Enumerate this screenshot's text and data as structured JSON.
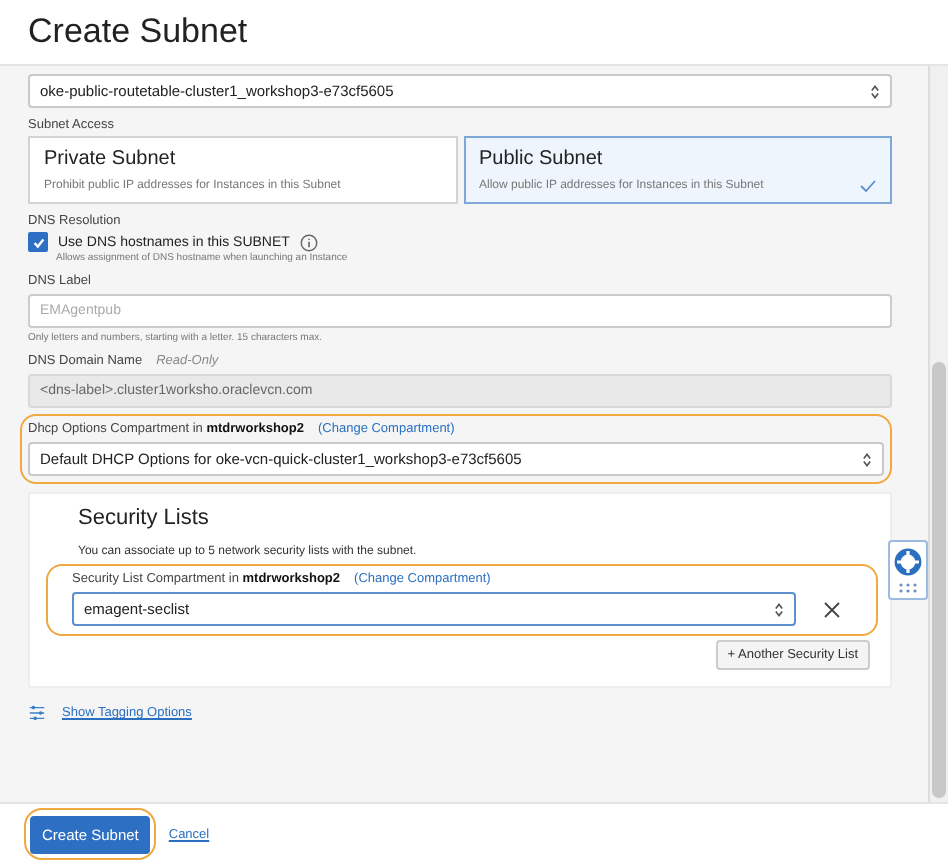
{
  "title": "Create Subnet",
  "route_table": {
    "value": "oke-public-routetable-cluster1_workshop3-e73cf5605"
  },
  "subnet_access": {
    "label": "Subnet Access",
    "options": [
      {
        "title": "Private Subnet",
        "description": "Prohibit public IP addresses for Instances in this Subnet",
        "selected": false
      },
      {
        "title": "Public Subnet",
        "description": "Allow public IP addresses for Instances in this Subnet",
        "selected": true
      }
    ]
  },
  "dns_resolution": {
    "label": "DNS Resolution",
    "checkbox_label": "Use DNS hostnames in this SUBNET",
    "checked": true,
    "help": "Allows assignment of DNS hostname when launching an Instance"
  },
  "dns_label": {
    "label": "DNS Label",
    "placeholder": "EMAgentpub",
    "hint": "Only letters and numbers, starting with a letter. 15 characters max."
  },
  "dns_domain": {
    "label": "DNS Domain Name",
    "note": "Read-Only",
    "value": "<dns-label>.cluster1worksho.oraclevcn.com"
  },
  "dhcp": {
    "label": "Dhcp Options Compartment in **mtdrworkshop2**",
    "link": "(Change Compartment)",
    "value": "Default DHCP Options for oke-vcn-quick-cluster1_workshop3-e73cf5605"
  },
  "security_lists": {
    "title": "Security Lists",
    "description": "You can associate up to 5 network security lists with the subnet.",
    "compartment_label": "Security List Compartment in **mtdrworkshop2**",
    "link": "(Change Compartment)",
    "value": "emagent-seclist",
    "add_button": "+ Another Security List"
  },
  "tagging_link": "Show Tagging Options",
  "buttons": {
    "create": "Create Subnet",
    "cancel": "Cancel"
  }
}
